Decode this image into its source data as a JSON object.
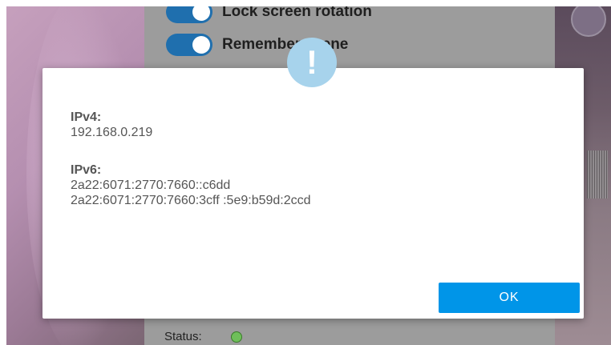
{
  "background": {
    "toggles": [
      {
        "label": "Lock screen rotation",
        "on": true
      },
      {
        "label": "Remember scene",
        "on": true
      }
    ],
    "status_label": "Status:",
    "status_color": "#6fbf5a"
  },
  "dialog": {
    "icon": "exclamation-icon",
    "icon_glyph": "!",
    "ipv4_label": "IPv4:",
    "ipv4_addresses": [
      "192.168.0.219"
    ],
    "ipv6_label": "IPv6:",
    "ipv6_addresses": [
      "2a22:6071:2770:7660::c6dd",
      "2a22:6071:2770:7660:3cff :5e9:b59d:2ccd"
    ],
    "ok_label": "OK",
    "accent_color": "#0095e8"
  }
}
